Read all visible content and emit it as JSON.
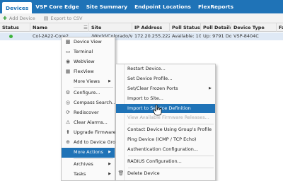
{
  "nav": {
    "tabs": [
      "Devices",
      "VSP Core Edge",
      "Site Summary",
      "Endpoint Locations",
      "FlexReports"
    ]
  },
  "toolbar": {
    "add_label": "Add Device",
    "export_label": "Export to CSV"
  },
  "grid": {
    "columns": [
      "Status",
      "Name",
      "Site",
      "IP Address",
      "Poll Status",
      "Poll Details",
      "Device Type",
      "Fa"
    ],
    "row": {
      "name": "Col-2A22-Core2",
      "site": "/World/Colorado/VSP...",
      "ip": "172.20.255.222",
      "poll_status": "Available: 10...",
      "poll_details": "Up: 9791 Do...",
      "device_type": "VSP-8404C"
    }
  },
  "context_menu": [
    {
      "label": "Device View",
      "icon": "device-view-icon"
    },
    {
      "label": "Terminal",
      "icon": "terminal-icon"
    },
    {
      "label": "WebView",
      "icon": "webview-icon"
    },
    {
      "label": "FlexView",
      "icon": "flexview-icon"
    },
    {
      "label": "More Views",
      "icon": "",
      "submenu": true
    },
    {
      "label": "Configure...",
      "icon": "gear-icon",
      "sep_before": true
    },
    {
      "label": "Compass Search...",
      "icon": "compass-icon"
    },
    {
      "label": "Rediscover",
      "icon": "rediscover-icon"
    },
    {
      "label": "Clear Alarms...",
      "icon": "clear-alarms-icon"
    },
    {
      "label": "Upgrade Firmware...",
      "icon": "upgrade-icon"
    },
    {
      "label": "Add to Device Group...",
      "icon": "add-group-icon"
    },
    {
      "label": "More Actions",
      "icon": "",
      "submenu": true,
      "highlighted": true
    },
    {
      "label": "Archives",
      "icon": "",
      "submenu": true,
      "sep_before": true
    },
    {
      "label": "Tasks",
      "icon": "",
      "submenu": true
    },
    {
      "label": "...",
      "icon": "",
      "submenu": true
    }
  ],
  "submenu": [
    {
      "label": "Restart Device..."
    },
    {
      "label": "Set Device Profile..."
    },
    {
      "label": "Set/Clear Frozen Ports",
      "submenu": true
    },
    {
      "label": "Import to Site..."
    },
    {
      "label": "Import to Service Definition",
      "highlighted": true
    },
    {
      "label": "View Available Firmware Releases...",
      "disabled": true
    },
    {
      "label": "Contact Device Using Group's Profile",
      "sep_before": true
    },
    {
      "label": "Ping Device (ICMP / TCP Echo)"
    },
    {
      "label": "Authentication Configuration..."
    },
    {
      "label": "RADIUS Configuration...",
      "sep_before": true
    },
    {
      "label": "Delete Device",
      "icon": "delete-icon",
      "sep_before": true
    },
    {
      "label": "..."
    }
  ],
  "colors": {
    "accent": "#1f73b7",
    "status_ok": "#3cb33c"
  }
}
